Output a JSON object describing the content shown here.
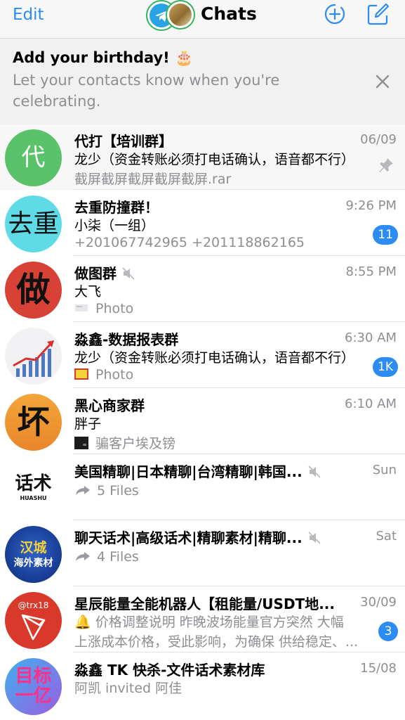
{
  "header": {
    "edit_label": "Edit",
    "title": "Chats",
    "new_story_icon": "plus-circle-icon",
    "compose_icon": "compose-icon"
  },
  "banner": {
    "title": "Add your birthday! 🎂",
    "text": "Let your contacts know when you're celebrating.",
    "close_icon": "close-icon"
  },
  "colors": {
    "accent": "#2d8cf2",
    "secondary_text": "#8e8e93",
    "unread_badge": "#2d8cf2"
  },
  "chats": [
    {
      "avatar_text": "代",
      "avatar_color": "#5ac36a",
      "name": "代打【培训群】",
      "time": "06/09",
      "sender": "龙少（资金转账必须打电话确认，语音都不行）",
      "preview": "截屏截屏截屏截屏截屏.rar",
      "pinned": true
    },
    {
      "avatar_text": "去重",
      "name": "去重防撞群！",
      "time": "9:26 PM",
      "sender": "小柒（一组）",
      "preview": "+201067742965 +201118862165",
      "unread": "11"
    },
    {
      "avatar_text": "做",
      "name": "做图群",
      "time": "8:55 PM",
      "sender": "大飞",
      "preview": "Photo",
      "muted": true
    },
    {
      "avatar_text": "",
      "name": "淼鑫-数据报表群",
      "time": "6:30 AM",
      "sender": "龙少（资金转账必须打电话确认，语音都不行）",
      "preview": "Photo",
      "unread": "1K"
    },
    {
      "avatar_text": "坏",
      "name": "黑心商家群",
      "time": "6:10 AM",
      "sender": "胖子",
      "preview": "骗客户埃及镑"
    },
    {
      "avatar_text": "话术",
      "avatar_subtext": "HUASHU",
      "name": "美国精聊|日本精聊|台湾精聊|韩国...",
      "time": "Sun",
      "preview": "5 Files",
      "muted": true
    },
    {
      "avatar_text": "汉城",
      "avatar_subtext": "海外素材",
      "name": "聊天话术|高级话术|精聊素材|精聊...",
      "time": "Sat",
      "preview": "4 Files",
      "muted": true
    },
    {
      "avatar_text": "@trx18",
      "name": "星辰能量全能机器人【租能量/USDT地...",
      "time": "30/09",
      "sender": "🔔 价格调整说明 昨晚波场能量官方突然 大幅",
      "preview": "上涨成本价格，受此影响，为确保 供给稳定、...",
      "unread": "3"
    },
    {
      "avatar_text": "目标一亿",
      "name": "淼鑫 TK 快杀-文件话术素材库",
      "time": "15/08",
      "sender": "阿凯 invited 阿佳"
    }
  ]
}
